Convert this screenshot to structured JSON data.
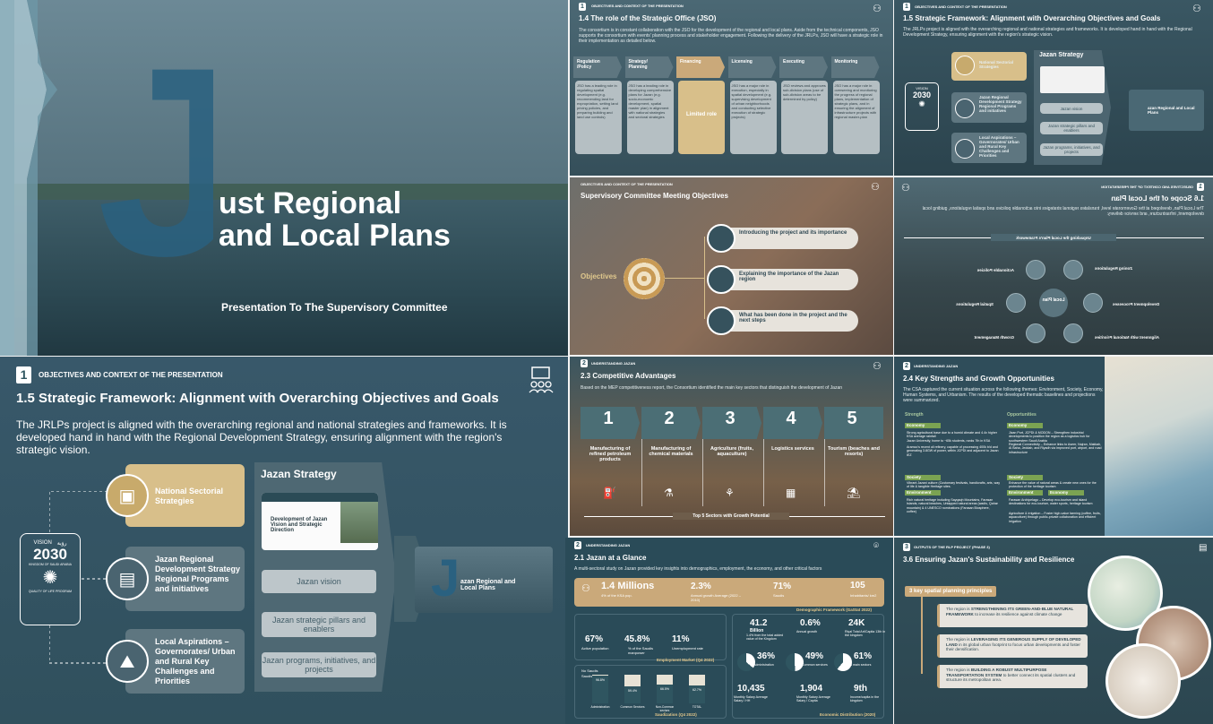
{
  "cover": {
    "big_letter": "J",
    "title_line1": "ust Regional",
    "title_line2": "and Local Plans",
    "subtitle": "Presentation To The Supervisory Committee"
  },
  "jso": {
    "num": "1",
    "section": "OBJECTIVES AND CONTEXT OF THE PRESENTATION",
    "title": "1.4  The role of the Strategic Office (JSO)",
    "body": "The consortium is in constant collaboration with the JSO  for the development of the regional and local plans. Aside from the technical components, JSO supports the consortium with events' planning process and stakeholder engagement. Following the delivery of the JRLPs, JSO will have a strategic role in their implementation as detailed below.",
    "columns": [
      {
        "head": "Regulation /Policy",
        "body": "JSO has a leading role in regulating spatial development (e.g. recommending land for expropriation, setting land pricing policies, and preparing building and land use controls)"
      },
      {
        "head": "Strategy/ Planning",
        "body": "JSO has a leading role in developing comprehensive plans for Jazan (e.g. socio-economic development, spatial master plan) in alignment with national strategies and sectoral strategies"
      },
      {
        "head": "Financing",
        "body": "Limited role"
      },
      {
        "head": "Licensing",
        "body": "JSO has a major role in execution, especially in spatial development (e.g. supervising development of urban neighborhoods and conducting selective execution of strategic projects)"
      },
      {
        "head": "Executing",
        "body": "JSO reviews and approves sub-division plans (use of sub-division areas to be determined by policy)"
      },
      {
        "head": "Monitoring",
        "body": "JSO has a major role in overseeing and monitoring the progress of regional plans, implementation of strategic plans, and in ensuring the alignment of infrastructure projects with regional master-plan"
      }
    ]
  },
  "frame": {
    "num": "1",
    "section": "OBJECTIVES AND CONTEXT OF THE PRESENTATION",
    "title": "1.5  Strategic Framework: Alignment with Overarching Objectives and Goals",
    "body": "The JRLPs project is aligned with the overarching regional and national strategies and frameworks. It is developed hand in hand with the Regional Development Strategy, ensuring alignment with the region's strategic vision.",
    "vision_label": "VISION",
    "vision_year": "2030",
    "vision_ar": "رؤية",
    "vision_kingdom": "KINGDOM OF SAUDI ARABIA",
    "vision_program": "QUALITY OF LIFE PROGRAM",
    "items": [
      {
        "label": "National Sectorial Strategies"
      },
      {
        "label": "Jazan Regional Development Strategy Regional Programs and initiatives"
      },
      {
        "label": "Local Aspirations – Governorates/ Urban and Rural Key Challenges and Priorities"
      }
    ],
    "strategy_title": "Jazan Strategy",
    "doc_title": "Development of Jazan Vision and Strategic Direction",
    "strategy_items": [
      "Jazan vision",
      "Jazan strategic pillars and enablers",
      "Jazan programs, initiatives, and projects"
    ],
    "thumb_letter": "J",
    "thumb_text": "azan Regional and Local Plans"
  },
  "committee": {
    "section": "OBJECTIVES AND CONTEXT OF THE PRESENTATION",
    "title": "Supervisory Committee Meeting Objectives",
    "label": "Objectives",
    "items": [
      "Introducing the project and its importance",
      "Explaining the importance of the Jazan region",
      "What has been done in the project and the next steps"
    ]
  },
  "scope": {
    "num": "1",
    "section": "OBJECTIVES AND CONTEXT OF THE PRESENTATION",
    "title": "1.6  Scope of the Local Plan",
    "body": "The Local Plan, developed at the Governorate level, translates regional strategies into actionable policies and spatial regulations, guiding local development, infrastructure, and service delivery.",
    "ring": "Unpacking the Local Plan's Framework",
    "center": "Local Plan",
    "nodes": [
      "Actionable Policies",
      "Zoning Regulations",
      "Spatial Regulations",
      "Development Processes",
      "Growth Management",
      "Alignment with National Priorities"
    ]
  },
  "comp": {
    "num": "2",
    "section": "UNDERSTANDING JAZAN",
    "title": "2.3  Competitive Advantages",
    "body": "Based on the MEP competitiveness report, the Consortium identified the main key sectors that distinguish the development of Jazan",
    "sectors": [
      {
        "num": "1",
        "label": "Manufacturing of refined petroleum products"
      },
      {
        "num": "2",
        "label": "Manufacturing of chemical materials"
      },
      {
        "num": "3",
        "label": "Agriculture (fruits, aquaculture)"
      },
      {
        "num": "4",
        "label": "Logistics services"
      },
      {
        "num": "5",
        "label": "Tourism (beaches and resorts)"
      }
    ],
    "footer": "Top 5 Sectors with Growth Potential"
  },
  "strength": {
    "num": "2",
    "section": "UNDERSTANDING JAZAN",
    "title": "2.4  Key Strengths and Growth Opportunities",
    "body": "The CSA captured the current situation across the following themes: Environment, Society, Economy, Human Systems, and Urbanism. The results of the developed thematic baselines and projections were summarized.",
    "col1": "Strength",
    "col2": "Opportunities",
    "tags": [
      "Economy",
      "Society",
      "Environment",
      "Economy",
      "Society",
      "Environment",
      "Economy"
    ],
    "strengths": [
      "Strong agricultural base due to a humid climate and 4.4x higher KSA average rainfall",
      "Jazan University, home to ~65k students, ranks 7th in KSA",
      "Aramco's recent oil refinery, capable of processing 400k b/d and generating 3.8GW of power, within JCPDI and adjacent to Jazan IEZ",
      "Vibrant Jazani culture (Customary festivals, handicrafts, arts, way of life & tangible Heritage sites.",
      "Rich natural heritage including Sayqaqh Mountains, Farasan Islands, natural beaches, Untapped natural areas (wadis, Qahar mountain) & 4 UNESCO nominations (Farasan Biosphere, coffee)"
    ],
    "opportunities": [
      "Jizan Port, JCPDI & MODON – Strengthen industrial developments to position the region as a logistics hub for southwestern Saudi Arabia",
      "Regional Connectivity – Enhance links to Aseer, Najran, Makkah, Al Baha, Jeddah, and Riyadh via improved port, airport, and road infrastructure",
      "Enhance the value of natural areas & create new ones for the protection of the heritage tourism",
      "Farasan Archipelago – Develop eco-tourism and island destinations for eco-tourism, water sports, heritage tourism",
      "Agriculture & irrigation – Foster high-value farming (coffee, fruits, aquaculture) through public-private collaboration and efficient irrigation"
    ]
  },
  "glance": {
    "num": "2",
    "section": "UNDERSTANDING JAZAN",
    "title": "2.1  Jazan at a Glance",
    "body": "A multi-sectoral study on Jazan provided key insights into demographics, employment, the economy, and other critical factors",
    "demo": [
      {
        "value": "1.4 Millions",
        "label": "4% of the KSA pop."
      },
      {
        "value": "2.3%",
        "label": "Annual growth Average (2022 – 2010)"
      },
      {
        "value": "71%",
        "label": "Saudis"
      },
      {
        "value": "105",
        "label": "Inhabitants/ km2"
      }
    ],
    "demo_src": "Demographic Framework (GaStat 2022)",
    "emp": [
      {
        "value": "67%",
        "label": "Active population"
      },
      {
        "value": "45.8%",
        "label": "% of the Saudis manpower"
      },
      {
        "value": "11%",
        "label": "Unemployment rate"
      }
    ],
    "emp_src": "Employment Market (Q4 2022)",
    "econ": [
      {
        "value": "41.2",
        "unit": "Billion",
        "label": "1.4% from the total added value of the Kingdom"
      },
      {
        "value": "0.6%",
        "label": "Annual growth"
      },
      {
        "value": "24K",
        "label": "Riyal Total Art/Capita 13th in the kingdom"
      },
      {
        "value": "36%",
        "label": "Administration",
        "frac": 0.36
      },
      {
        "value": "49%",
        "label": "Common services",
        "frac": 0.49
      },
      {
        "value": "61%",
        "label": "3 main sectors",
        "frac": 0.61
      },
      {
        "value": "10,435",
        "label": "Monthly Salary Average Salary / HH"
      },
      {
        "value": "1,904",
        "label": "Monthly Salary Average Salary / Capita"
      },
      {
        "value": "9th",
        "label": "Income/capita in the kingdom"
      }
    ],
    "econ_src": "Economic Distribution (2020)",
    "saud_legend": [
      "No Saudis",
      "Saudis"
    ],
    "saud_bars": [
      {
        "label": "Administration",
        "value": "96.8%",
        "frac": 0.968
      },
      {
        "label": "Common Services",
        "value": "59.4%",
        "frac": 0.594
      },
      {
        "label": "Non-Common sectors",
        "value": "66.5%",
        "frac": 0.665
      },
      {
        "label": "TOTAL",
        "value": "62.7%",
        "frac": 0.627
      }
    ],
    "saud_src": "Saudization (Q4 2022)"
  },
  "sustain": {
    "num": "3",
    "section": "OUTPUTS OF THE RLP PROJECT (PHASE 3)",
    "title": "3.6  Ensuring Jazan's Sustainability and Resilience",
    "principles": "3 key spatial planning principles",
    "items": [
      {
        "lead": "The region is ",
        "bold": "STRENGTHENING ITS GREEN-AND-BLUE NATURAL FRAMEWORK",
        "tail": " to increase its resilience against climate change"
      },
      {
        "lead": "The region is ",
        "bold": "LEVERAGING ITS GENEROUS SUPPLY OF DEVELOPED LAND",
        "tail": " in its global urban footprint to focus urban developments and foster their densification."
      },
      {
        "lead": "The region is ",
        "bold": "BUILDING A ROBUST MULTIPURPOSE TRANSPORTATION SYSTEM",
        "tail": " to better connect its spatial clusters and structure its metropolitan area."
      }
    ]
  },
  "colors": {
    "teal": "#2f5560",
    "gold": "#d8bf8a",
    "panel": "#5e7680"
  },
  "icons": [
    "people-icon",
    "target-icon",
    "document-icon",
    "chart-icon"
  ]
}
